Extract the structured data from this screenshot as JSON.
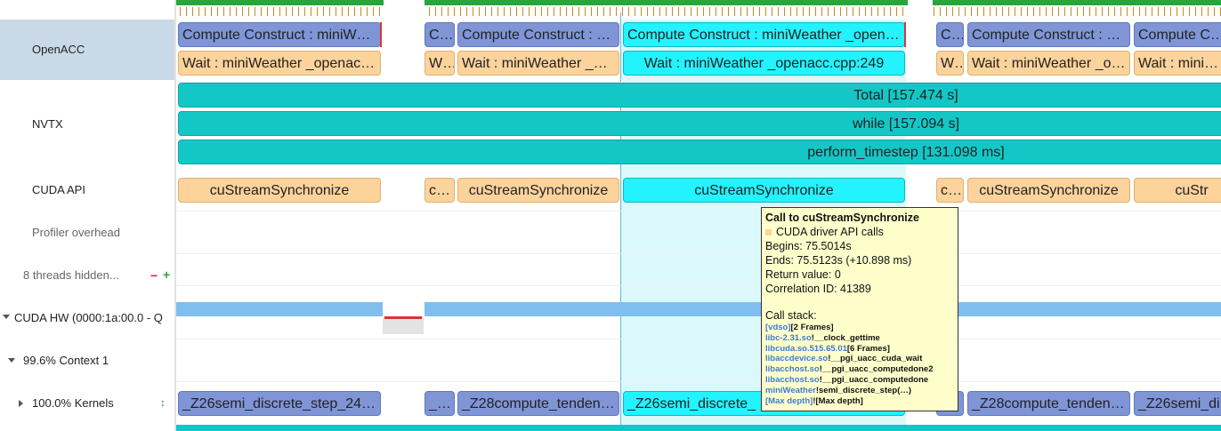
{
  "rows": {
    "openacc": "OpenACC",
    "nvtx": "NVTX",
    "cuda_api": "CUDA API",
    "profiler_overhead": "Profiler overhead",
    "threads_hidden": "8 threads hidden...",
    "minus": "−",
    "plus": "+",
    "cuda_hw": "CUDA HW (0000:1a:00.0 - Q",
    "context": "99.6% Context 1",
    "kernels": "100.0% Kernels",
    "sort_icon": "↕"
  },
  "openacc": {
    "compute": [
      "Compute Construct : miniWe…",
      "C…",
      "Compute Construct : …",
      "Compute Construct : miniWeather _open…",
      "C…",
      "Compute Construct : …",
      "Compute Construct"
    ],
    "wait": [
      "Wait : miniWeather _openacc…",
      "W…",
      "Wait : miniWeather _o…",
      "Wait : miniWeather _openacc.cpp:249",
      "W…",
      "Wait : miniWeather _o…",
      "Wait : miniWei"
    ]
  },
  "nvtx": {
    "total": "Total [157.474 s]",
    "while": "while [157.094 s]",
    "perform": "perform_timestep [131.098 ms]"
  },
  "cuda_api": [
    "cuStreamSynchronize",
    "c…",
    "cuStreamSynchronize",
    "cuStreamSynchronize",
    "c…",
    "cuStreamSynchronize",
    "cuStr"
  ],
  "kernels": [
    "_Z26semi_discrete_step_24…",
    "_…",
    "_Z28compute_tenden…",
    "_Z26semi_discrete_",
    "_Z28compute_tenden…",
    "_Z26semi_di"
  ],
  "tooltip": {
    "title": "Call to cuStreamSynchronize",
    "category": "CUDA driver API calls",
    "begins": "Begins: 75.5014s",
    "ends": "Ends: 75.5123s (+10.898 ms)",
    "return_value": "Return value: 0",
    "correlation": "Correlation ID: 41389",
    "call_stack_label": "Call stack:",
    "stack": [
      {
        "lib": "[vdso]",
        "fn": "[2 Frames]"
      },
      {
        "lib": "libc-2.31.so",
        "fn": "!__clock_gettime"
      },
      {
        "lib": "libcuda.so.515.65.01",
        "fn": "[6 Frames]"
      },
      {
        "lib": "libaccdevice.so",
        "fn": "!__pgi_uacc_cuda_wait"
      },
      {
        "lib": "libacchost.so",
        "fn": "!__pgi_uacc_computedone2"
      },
      {
        "lib": "libacchost.so",
        "fn": "!__pgi_uacc_computedone"
      },
      {
        "lib": "miniWeather",
        "fn": "!semi_discrete_step(…)"
      },
      {
        "lib": "[Max depth]",
        "fn": "![Max depth]"
      }
    ],
    "colors": {
      "category_square": "#fcd39b",
      "background": "#ffffcc"
    }
  },
  "colors": {
    "selected_row": "#c9d9e8",
    "compute_blue": "#7f95d6",
    "wait_orange": "#fcd39b",
    "nvtx_teal": "#13c7c7",
    "selection_cyan": "#23f2ff",
    "hw_blue": "#7fbfef",
    "top_green": "#2aa43c"
  }
}
